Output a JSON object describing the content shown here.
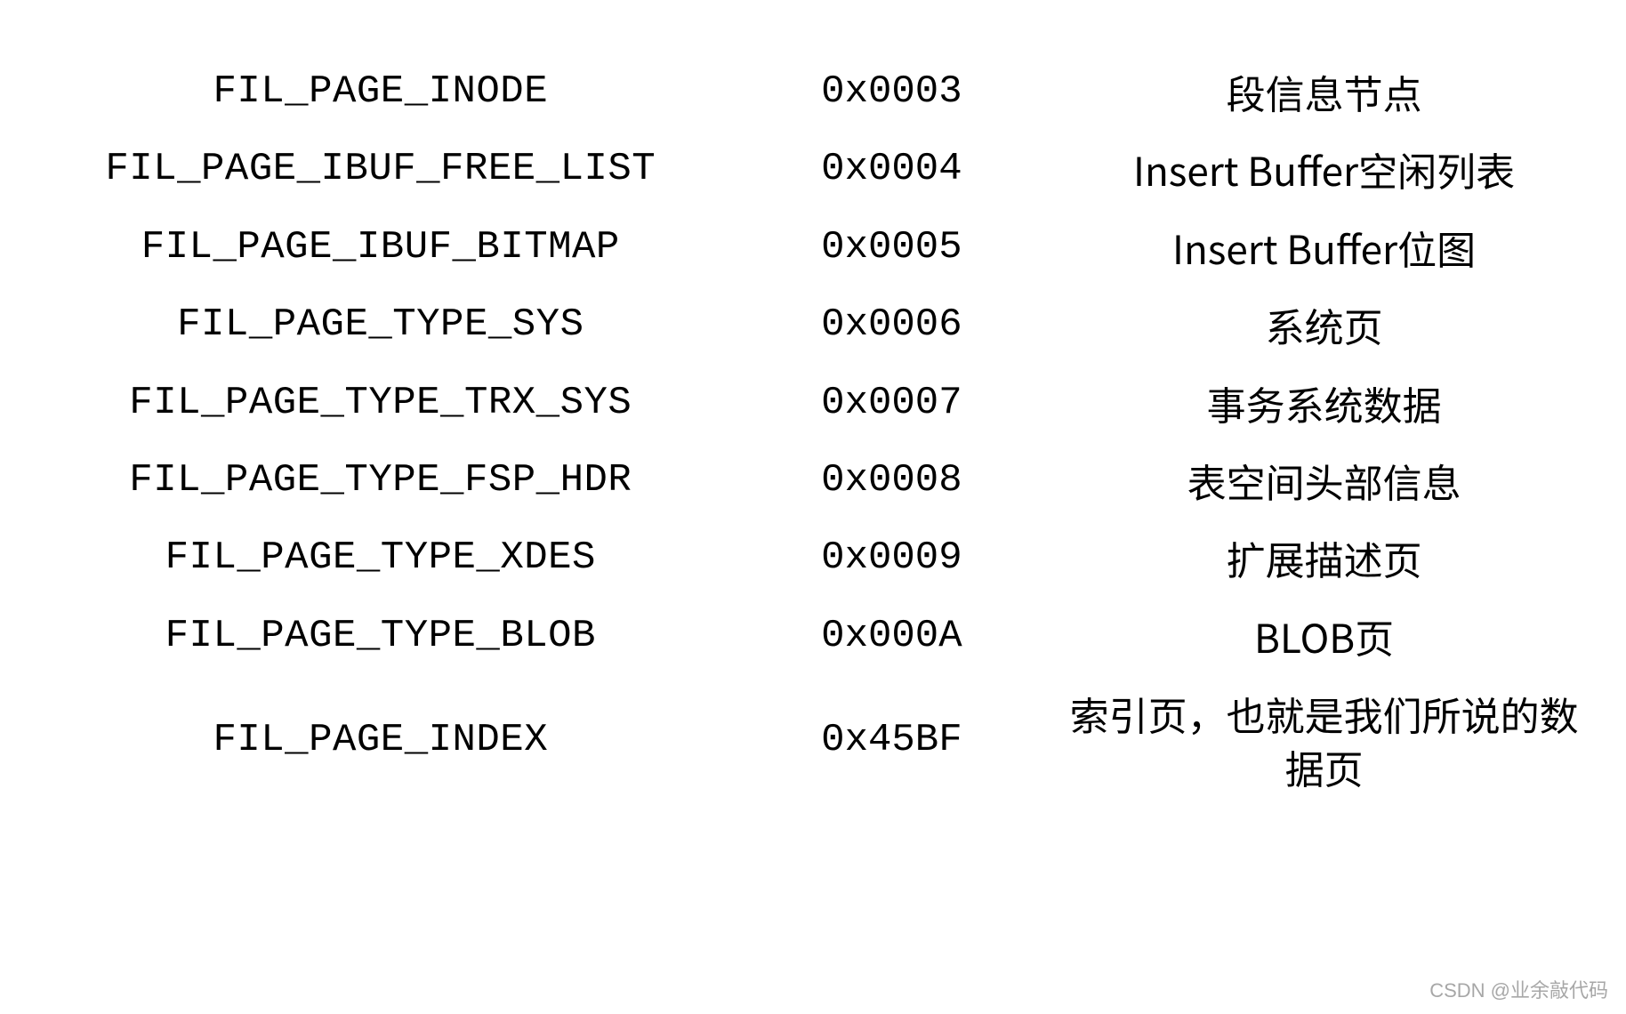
{
  "rows": [
    {
      "name": "FIL_PAGE_INODE",
      "hex": "0x0003",
      "desc": "段信息节点"
    },
    {
      "name": "FIL_PAGE_IBUF_FREE_LIST",
      "hex": "0x0004",
      "desc": "Insert Buffer空闲列表"
    },
    {
      "name": "FIL_PAGE_IBUF_BITMAP",
      "hex": "0x0005",
      "desc": "Insert Buffer位图"
    },
    {
      "name": "FIL_PAGE_TYPE_SYS",
      "hex": "0x0006",
      "desc": "系统页"
    },
    {
      "name": "FIL_PAGE_TYPE_TRX_SYS",
      "hex": "0x0007",
      "desc": "事务系统数据"
    },
    {
      "name": "FIL_PAGE_TYPE_FSP_HDR",
      "hex": "0x0008",
      "desc": "表空间头部信息"
    },
    {
      "name": "FIL_PAGE_TYPE_XDES",
      "hex": "0x0009",
      "desc": "扩展描述页"
    },
    {
      "name": "FIL_PAGE_TYPE_BLOB",
      "hex": "0x000A",
      "desc": "BLOB页"
    },
    {
      "name": "FIL_PAGE_INDEX",
      "hex": "0x45BF",
      "desc": "索引页，也就是我们所说的数据页"
    }
  ],
  "watermark": "CSDN @业余敲代码"
}
